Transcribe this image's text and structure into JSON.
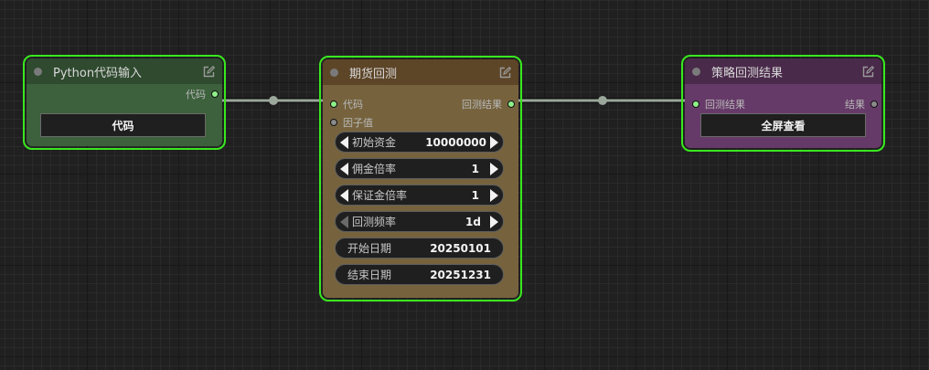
{
  "nodes": {
    "python_input": {
      "title": "Python代码输入",
      "output_label": "代码",
      "button_label": "代码",
      "title_color": "#2f4a2f",
      "body_color": "#3d613d"
    },
    "futures_backtest": {
      "title": "期货回测",
      "input_code": "代码",
      "input_factor": "因子值",
      "output_label": "回测结果",
      "widgets": [
        {
          "label": "初始资金",
          "value": "10000000"
        },
        {
          "label": "佣金倍率",
          "value": "1"
        },
        {
          "label": "保证金倍率",
          "value": "1"
        },
        {
          "label": "回测频率",
          "value": "1d"
        },
        {
          "label": "开始日期",
          "value": "20250101"
        },
        {
          "label": "结束日期",
          "value": "20251231"
        }
      ],
      "title_color": "#5d4528",
      "body_color": "#76633e"
    },
    "strategy_result": {
      "title": "策略回测结果",
      "input_label": "回测结果",
      "output_label": "结果",
      "button_label": "全屏查看",
      "title_color": "#4a2a4a",
      "body_color": "#663a68"
    }
  },
  "colors": {
    "selection_border": "#39e81f",
    "link": "#9aa79a",
    "slot_connected": "#8ff08a",
    "slot_empty": "#8a8a8a"
  },
  "icons": [
    "edit-icon",
    "arrow-left-icon",
    "arrow-right-icon"
  ]
}
